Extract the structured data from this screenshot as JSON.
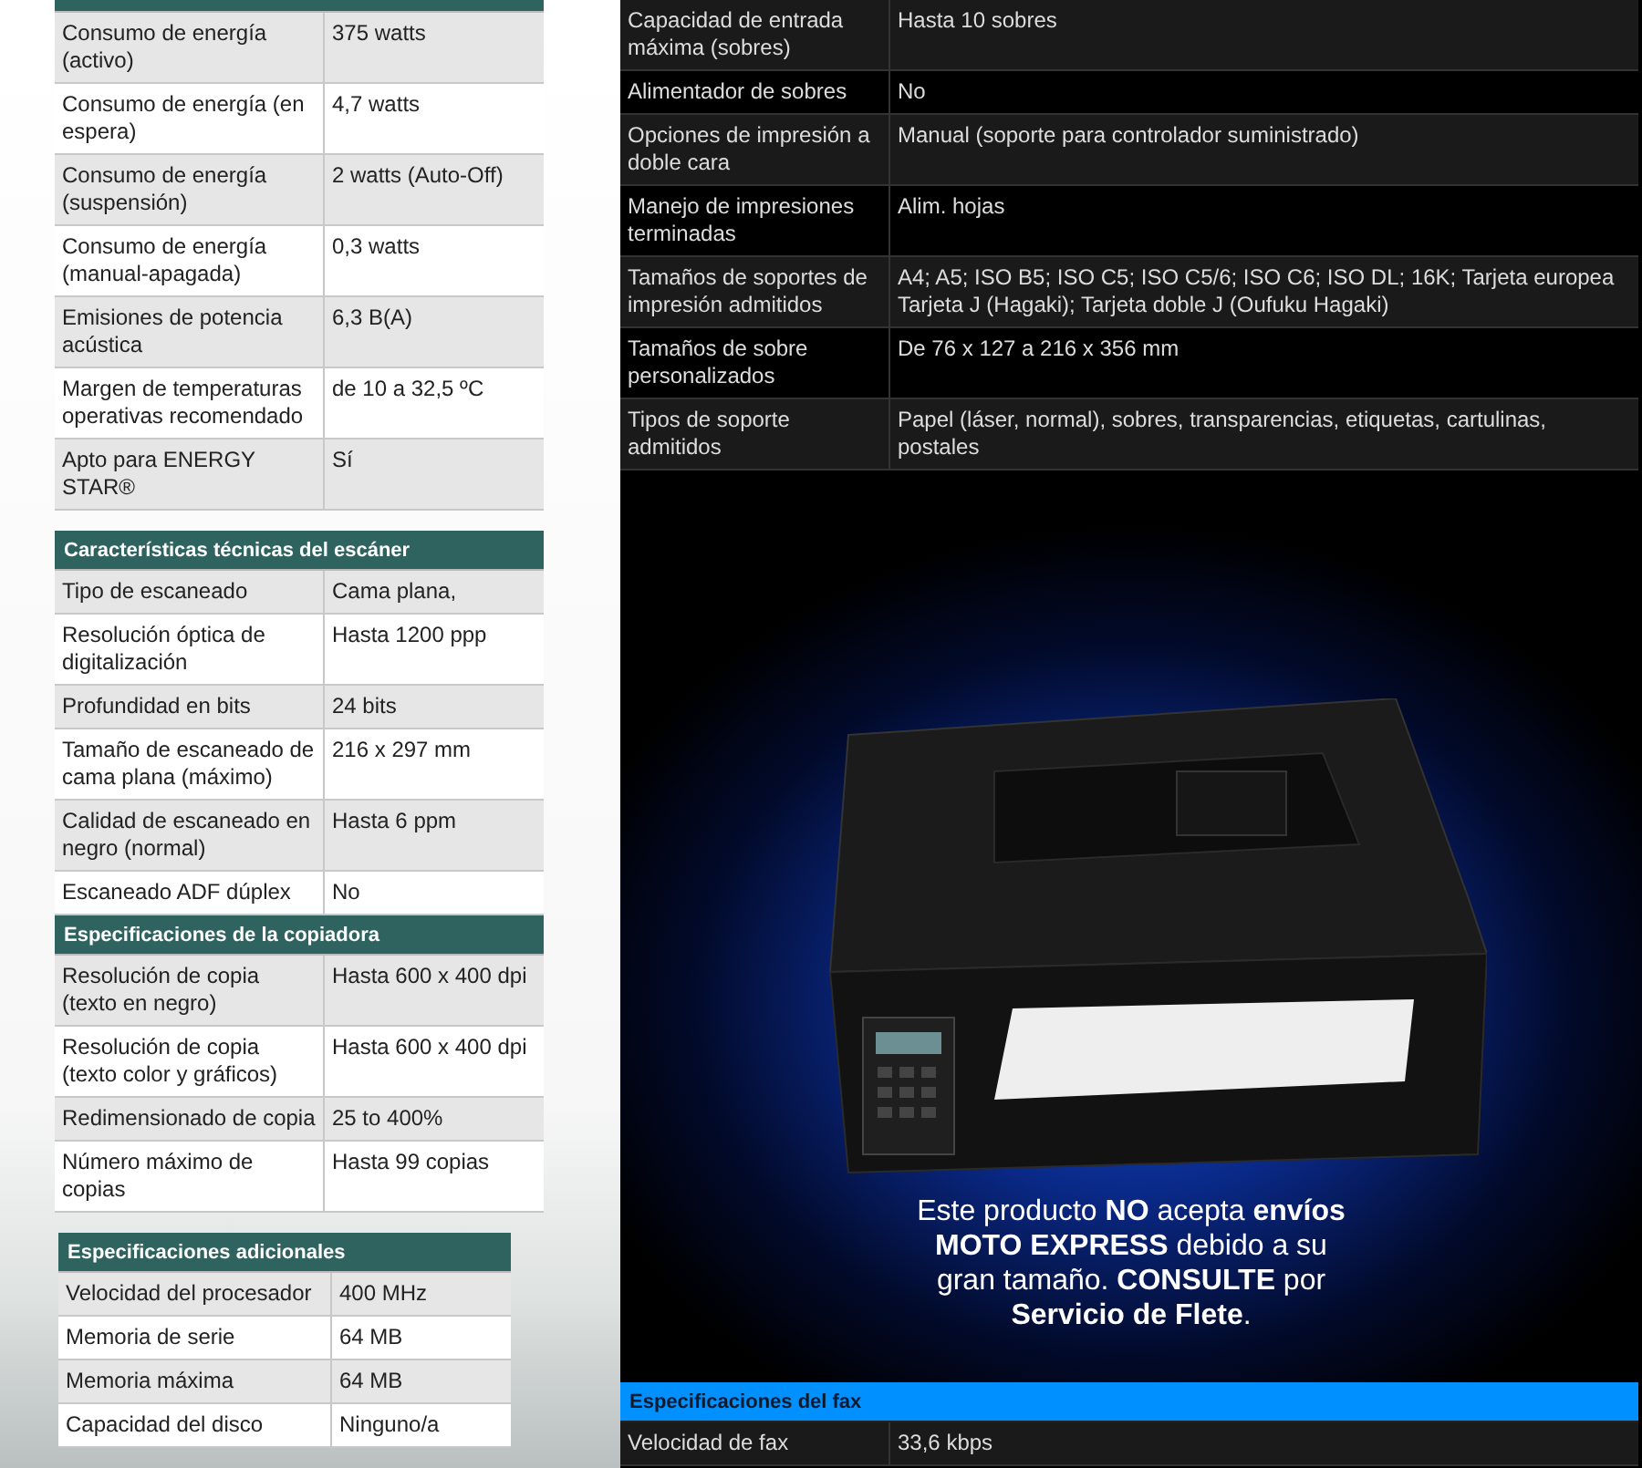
{
  "left_sections": [
    {
      "rows": [
        [
          "Consumo de energía (activo)",
          "375 watts"
        ],
        [
          "Consumo de energía (en espera)",
          "4,7 watts"
        ],
        [
          "Consumo de energía (suspensión)",
          "2 watts (Auto-Off)"
        ],
        [
          "Consumo de energía (manual-apagada)",
          "0,3 watts"
        ],
        [
          "Emisiones de potencia acústica",
          "6,3 B(A)"
        ],
        [
          "Margen de temperaturas operativas recomendado",
          "de 10 a 32,5 ºC"
        ],
        [
          "Apto para ENERGY STAR®",
          "Sí"
        ]
      ]
    },
    {
      "title": "Características técnicas del escáner",
      "rows": [
        [
          "Tipo de escaneado",
          "Cama plana,"
        ],
        [
          "Resolución óptica de digitalización",
          "Hasta 1200 ppp"
        ],
        [
          "Profundidad en bits",
          "24 bits"
        ],
        [
          "Tamaño de escaneado de cama plana (máximo)",
          "216 x 297 mm"
        ],
        [
          "Calidad de escaneado en negro (normal)",
          "Hasta 6 ppm"
        ],
        [
          "Escaneado ADF dúplex",
          "No"
        ]
      ]
    },
    {
      "title": "Especificaciones de la copiadora",
      "rows": [
        [
          "Resolución de copia (texto en negro)",
          "Hasta 600 x 400 dpi"
        ],
        [
          "Resolución de copia (texto color y gráficos)",
          "Hasta 600 x 400 dpi"
        ],
        [
          "Redimensionado de copia",
          "25 to 400%"
        ],
        [
          "Número máximo de copias",
          "Hasta 99 copias"
        ]
      ]
    },
    {
      "title": "Especificaciones adicionales",
      "rows": [
        [
          "Velocidad del procesador",
          "400 MHz"
        ],
        [
          "Memoria de serie",
          "64 MB"
        ],
        [
          "Memoria máxima",
          "64 MB"
        ],
        [
          "Capacidad del disco",
          "Ninguno/a"
        ]
      ]
    }
  ],
  "right_table": {
    "rows": [
      [
        "Capacidad de entrada máxima (sobres)",
        "Hasta 10 sobres"
      ],
      [
        "Alimentador de sobres",
        "No"
      ],
      [
        "Opciones de impresión a doble cara",
        "Manual (soporte para controlador suministrado)"
      ],
      [
        "Manejo de impresiones terminadas",
        "Alim. hojas"
      ],
      [
        "Tamaños de soportes de impresión admitidos",
        "A4; A5; ISO B5; ISO C5; ISO C5/6; ISO C6; ISO DL; 16K; Tarjeta europea Tarjeta J (Hagaki); Tarjeta doble J (Oufuku Hagaki)"
      ],
      [
        "Tamaños de sobre personalizados",
        "De 76 x 127 a 216 x 356 mm"
      ],
      [
        "Tipos de soporte admitidos",
        "Papel (láser, normal), sobres, transparencias, etiquetas, cartulinas, postales"
      ]
    ]
  },
  "promo": {
    "message": "Este producto **NO** acepta **envíos MOTO EXPRESS** debido a su gran tamaño. **CONSULTE** por **Servicio de Flete**."
  },
  "fax_section": {
    "title": "Especificaciones del fax",
    "rows": [
      [
        "Velocidad de fax",
        "33,6 kbps"
      ]
    ]
  }
}
